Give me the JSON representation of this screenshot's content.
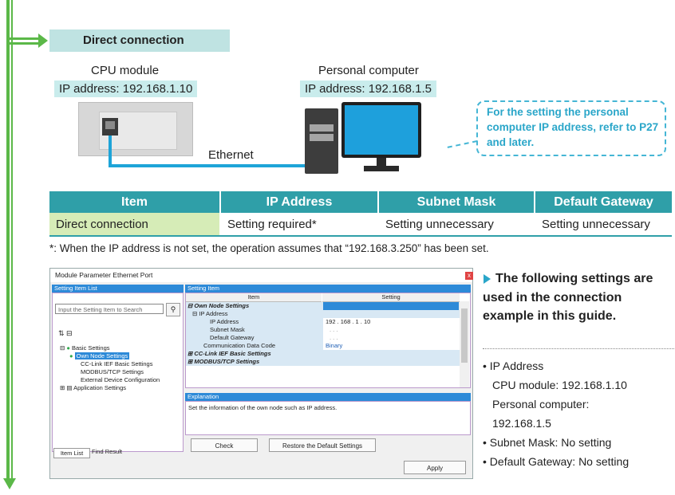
{
  "section": {
    "heading": "Direct connection"
  },
  "cpu": {
    "label": "CPU module",
    "ip": "IP address: 192.168.1.10"
  },
  "pc": {
    "label": "Personal computer",
    "ip": "IP address: 192.168.1.5"
  },
  "ethernet_label": "Ethernet",
  "callout": {
    "text": "For the setting the personal computer IP address, refer to P27 and later."
  },
  "table": {
    "headers": [
      "Item",
      "IP Address",
      "Subnet Mask",
      "Default Gateway"
    ],
    "row": [
      "Direct connection",
      "Setting required*",
      "Setting unnecessary",
      "Setting unnecessary"
    ]
  },
  "footnote": "*: When the IP address is not set, the operation assumes that “192.168.3.250” has been set.",
  "dialog": {
    "title": "Module Parameter Ethernet Port",
    "left_header": "Setting Item List",
    "search_placeholder": "Input the Setting Item to Search",
    "tree": [
      "Basic Settings",
      "Own Node Settings",
      "CC-Link IEF Basic Settings",
      "MODBUS/TCP Settings",
      "External Device Configuration",
      "Application Settings"
    ],
    "tabs": [
      "Item List",
      "Find Result"
    ],
    "right_header": "Setting Item",
    "grid_headers": [
      "Item",
      "Setting"
    ],
    "rows": [
      {
        "item": "Own Node Settings",
        "setting": ""
      },
      {
        "item": "IP Address",
        "setting": ""
      },
      {
        "item": "IP Address",
        "setting": "192 . 168 . 1 . 10"
      },
      {
        "item": "Subnet Mask",
        "setting": ". . ."
      },
      {
        "item": "Default Gateway",
        "setting": ". . ."
      },
      {
        "item": "Communication Data Code",
        "setting": "Binary"
      },
      {
        "item": "CC-Link IEF Basic Settings",
        "setting": ""
      },
      {
        "item": "MODBUS/TCP Settings",
        "setting": ""
      }
    ],
    "explanation_header": "Explanation",
    "explanation": "Set the information of the own node such as IP address.",
    "buttons": {
      "check": "Check",
      "restore": "Restore the Default Settings",
      "apply": "Apply"
    }
  },
  "info": {
    "heading": "The following settings are used in the connection example in this guide.",
    "lines": [
      "• IP Address",
      "CPU module: 192.168.1.10",
      "Personal computer:",
      "192.168.1.5",
      "• Subnet Mask: No setting",
      "• Default Gateway: No setting"
    ]
  },
  "colors": {
    "accent_green": "#5bb848",
    "table_header": "#2f9fa8",
    "callout": "#2aa6c9",
    "selection_blue": "#2d8ad8"
  }
}
